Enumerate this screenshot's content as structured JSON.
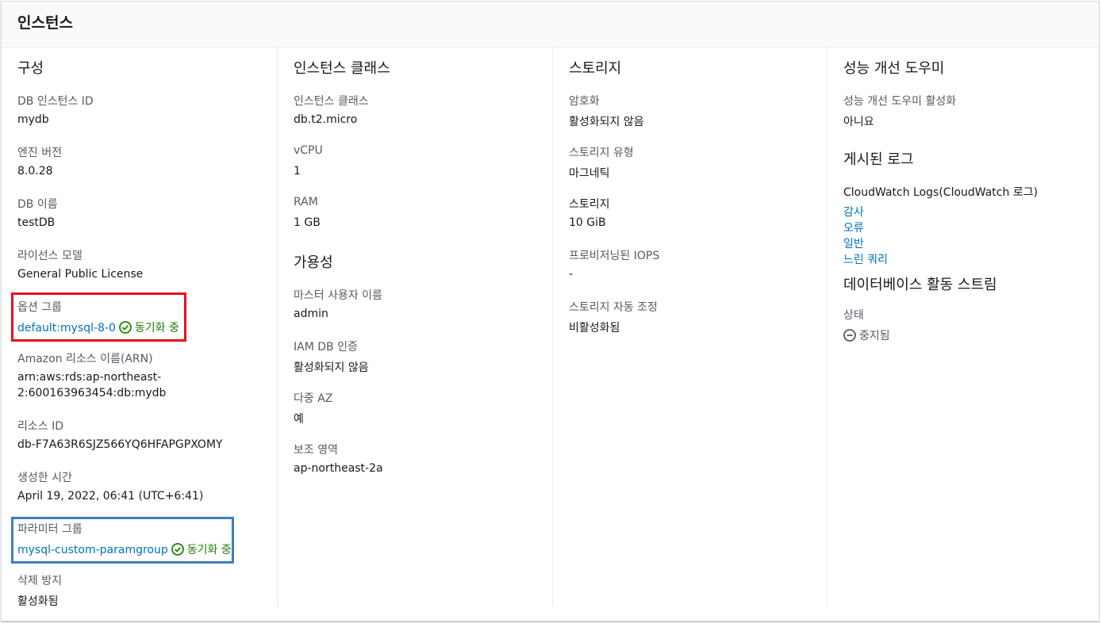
{
  "header": {
    "title": "인스턴스"
  },
  "config": {
    "heading": "구성",
    "db_instance_id_label": "DB 인스턴스 ID",
    "db_instance_id": "mydb",
    "engine_version_label": "엔진 버전",
    "engine_version": "8.0.28",
    "db_name_label": "DB 이름",
    "db_name": "testDB",
    "license_label": "라이선스 모델",
    "license": "General Public License",
    "option_group_label": "옵션 그룹",
    "option_group": "default:mysql-8-0",
    "option_group_status": "동기화 중",
    "arn_label": "Amazon 리소스 이름(ARN)",
    "arn_line1": "arn:aws:rds:ap-northeast-",
    "arn_line2": "2:600163963454:db:mydb",
    "resource_id_label": "리소스 ID",
    "resource_id": "db-F7A63R6SJZ566YQ6HFAPGPXOMY",
    "created_label": "생성한 시간",
    "created": "April 19, 2022, 06:41 (UTC+6:41)",
    "param_group_label": "파라미터 그룹",
    "param_group": "mysql-custom-paramgroup",
    "param_group_status": "동기화 중",
    "deletion_label": "삭제 방지",
    "deletion": "활성화됨"
  },
  "instance_class": {
    "heading": "인스턴스 클래스",
    "class_label": "인스턴스 클래스",
    "class": "db.t2.micro",
    "vcpu_label": "vCPU",
    "vcpu": "1",
    "ram_label": "RAM",
    "ram": "1 GB"
  },
  "availability": {
    "heading": "가용성",
    "master_user_label": "마스터 사용자 이름",
    "master_user": "admin",
    "iam_label": "IAM DB 인증",
    "iam": "활성화되지 않음",
    "multi_az_label": "다중 AZ",
    "multi_az": "예",
    "secondary_zone_label": "보조 영역",
    "secondary_zone": "ap-northeast-2a"
  },
  "storage": {
    "heading": "스토리지",
    "encryption_label": "암호화",
    "encryption": "활성화되지 않음",
    "type_label": "스토리지 유형",
    "type": "마그네틱",
    "size_label": "스토리지",
    "size": "10 GiB",
    "iops_label": "프로비저닝된 IOPS",
    "iops": "-",
    "autoscaling_label": "스토리지 자동 조정",
    "autoscaling": "비활성화됨"
  },
  "performance": {
    "heading": "성능 개선 도우미",
    "enabled_label": "성능 개선 도우미 활성화",
    "enabled": "아니요"
  },
  "logs": {
    "heading": "게시된 로그",
    "cloudwatch_label": "CloudWatch Logs(CloudWatch 로그)",
    "items": [
      "감사",
      "오류",
      "일반",
      "느린 쿼리"
    ]
  },
  "activity_stream": {
    "heading": "데이터베이스 활동 스트림",
    "status_label": "상태",
    "status": "중지됨"
  },
  "icons": {
    "synced": "check-circle-icon",
    "stopped": "minus-circle-icon"
  },
  "colors": {
    "link": "#0073bb",
    "success": "#1d8102",
    "highlight_red": "#e4121e",
    "highlight_blue": "#3f7fbf"
  }
}
